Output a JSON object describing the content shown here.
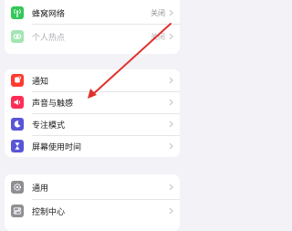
{
  "network": {
    "items": [
      {
        "label": "蜂窝网络",
        "value": "关闭",
        "icon": "cellular-antenna-icon",
        "color": "#34c759"
      },
      {
        "label": "个人热点",
        "value": "关闭",
        "icon": "hotspot-link-icon",
        "color": "#34c759"
      }
    ]
  },
  "notify": {
    "items": [
      {
        "label": "通知",
        "icon": "bell-icon",
        "color": "#ff3b30"
      },
      {
        "label": "声音与触感",
        "icon": "speaker-icon",
        "color": "#ff2d55"
      },
      {
        "label": "专注模式",
        "icon": "moon-icon",
        "color": "#5856d6"
      },
      {
        "label": "屏幕使用时间",
        "icon": "hourglass-icon",
        "color": "#5856d6"
      }
    ]
  },
  "general": {
    "items": [
      {
        "label": "通用",
        "icon": "gear-icon",
        "color": "#8e8e93"
      },
      {
        "label": "控制中心",
        "icon": "toggles-icon",
        "color": "#8e8e93"
      }
    ]
  },
  "annotation": {
    "color": "#e0302b"
  }
}
